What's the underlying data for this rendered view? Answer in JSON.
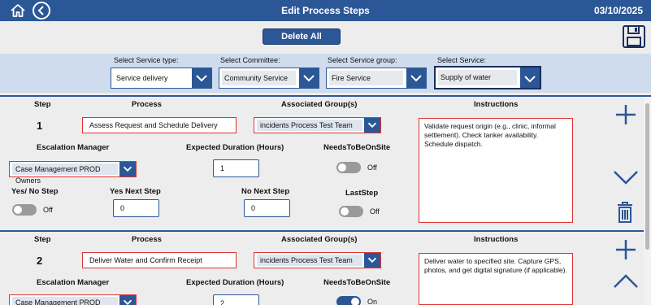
{
  "header": {
    "title": "Edit Process Steps",
    "date": "03/10/2025"
  },
  "toolbar": {
    "delete_all_label": "Delete All"
  },
  "filters": [
    {
      "label": "Select Service type:",
      "value": "Service delivery"
    },
    {
      "label": "Select Committee:",
      "value": "Community Service"
    },
    {
      "label": "Select Service group:",
      "value": "Fire Service"
    },
    {
      "label": "Select Service:",
      "value": "Supply of water"
    }
  ],
  "labels": {
    "step": "Step",
    "process": "Process",
    "associated_groups": "Associated Group(s)",
    "instructions": "Instructions",
    "escalation_manager": "Escalation Manager",
    "expected_duration": "Expected Duration (Hours)",
    "needs_on_site": "NeedsToBeOnSite",
    "yes_no_step": "Yes/ No Step",
    "yes_next_step": "Yes Next Step",
    "no_next_step": "No Next Step",
    "last_step": "LastStep"
  },
  "steps": [
    {
      "number": "1",
      "process": "Assess Request and Schedule Delivery",
      "group": "incidents Process Test Team",
      "instructions": "Validate request origin (e.g., clinic, informal settlement). Check tanker availability. Schedule dispatch.",
      "escalation_manager": "Case Management PROD Owners",
      "expected_duration": "1",
      "needs_on_site": "Off",
      "yes_no_step": "Off",
      "yes_next_step": "0",
      "no_next_step": "0",
      "last_step": "Off"
    },
    {
      "number": "2",
      "process": "Deliver Water and Confirm Receipt",
      "group": "incidents Process Test Team",
      "instructions": "Deliver water to specified site. Capture GPS, photos, and get digital signature (if applicable).",
      "escalation_manager": "Case Management PROD Owners",
      "expected_duration": "2",
      "needs_on_site": "On"
    }
  ],
  "colors": {
    "header": "#2b5797",
    "filter_bar": "#cfdcee",
    "required_border": "#dd3333"
  }
}
